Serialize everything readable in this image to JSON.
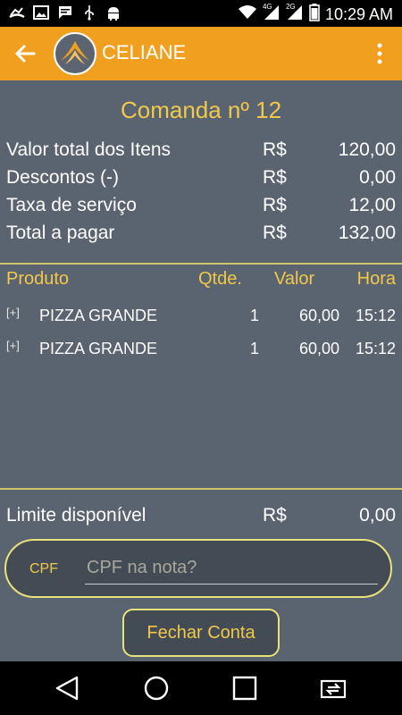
{
  "status_bar": {
    "time": "10:29 AM",
    "left_icons": [
      "missed-call-icon",
      "image-icon",
      "message-icon",
      "usb-icon",
      "android-icon"
    ],
    "right_icons": [
      "wifi-icon",
      "signal-4g-icon",
      "signal-2g-icon",
      "battery-icon"
    ],
    "net_4g": "4G",
    "net_2g": "2G"
  },
  "appbar": {
    "title": "CELIANE",
    "bg_color": "#f0a01e"
  },
  "comanda": {
    "title": "Comanda nº 12"
  },
  "summary": [
    {
      "label": "Valor total dos Itens",
      "currency": "R$",
      "value": "120,00"
    },
    {
      "label": "Descontos (-)",
      "currency": "R$",
      "value": "0,00"
    },
    {
      "label": "Taxa de serviço",
      "currency": "R$",
      "value": "12,00"
    },
    {
      "label": "Total a pagar",
      "currency": "R$",
      "value": "132,00"
    }
  ],
  "table": {
    "headers": {
      "produto": "Produto",
      "qtde": "Qtde.",
      "valor": "Valor",
      "hora": "Hora"
    },
    "rows": [
      {
        "expand": "[+]",
        "product": "PIZZA GRANDE",
        "qty": "1",
        "value": "60,00",
        "time": "15:12"
      },
      {
        "expand": "[+]",
        "product": "PIZZA GRANDE",
        "qty": "1",
        "value": "60,00",
        "time": "15:12"
      }
    ]
  },
  "limit": {
    "label": "Limite disponível",
    "currency": "R$",
    "value": "0,00"
  },
  "cpf": {
    "label": "CPF",
    "placeholder": "CPF na nota?",
    "value": ""
  },
  "close_button": {
    "label": "Fechar Conta"
  },
  "colors": {
    "accent": "#f2c84b",
    "border": "#e8e27a",
    "background": "#5a6470"
  }
}
